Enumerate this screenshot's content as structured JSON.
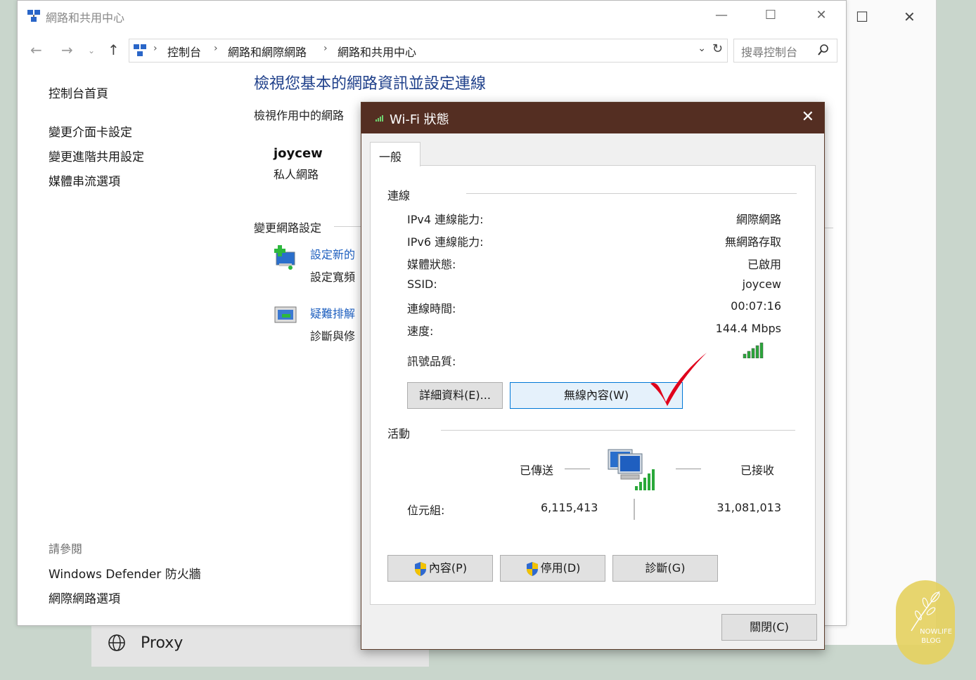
{
  "background": {
    "proxy_label": "Proxy"
  },
  "control_panel": {
    "title": "網路和共用中心",
    "address": {
      "crumbs": [
        "控制台",
        "網路和網際網路",
        "網路和共用中心"
      ]
    },
    "search_placeholder": "搜尋控制台",
    "sidebar": {
      "home": "控制台首頁",
      "links": [
        "變更介面卡設定",
        "變更進階共用設定",
        "媒體串流選項"
      ],
      "see_also_title": "請參閱",
      "see_also": [
        "Windows Defender 防火牆",
        "網際網路選項"
      ]
    },
    "main": {
      "title": "檢視您基本的網路資訊並設定連線",
      "active_networks": "檢視作用中的網路",
      "network_name": "joycew",
      "network_type": "私人網路",
      "change_settings": "變更網路設定",
      "tasks": [
        {
          "link": "設定新的",
          "desc": "設定寬頻"
        },
        {
          "link": "疑難排解",
          "desc": "診斷與修"
        }
      ]
    }
  },
  "wifi_dialog": {
    "title": "Wi-Fi 狀態",
    "tab": "一般",
    "connection_group": "連線",
    "rows": [
      {
        "label": "IPv4 連線能力:",
        "value": "網際網路"
      },
      {
        "label": "IPv6 連線能力:",
        "value": "無網路存取"
      },
      {
        "label": "媒體狀態:",
        "value": "已啟用"
      },
      {
        "label": "SSID:",
        "value": "joycew"
      },
      {
        "label": "連線時間:",
        "value": "00:07:16"
      },
      {
        "label": "速度:",
        "value": "144.4 Mbps"
      }
    ],
    "signal_label": "訊號品質:",
    "signal_bars": 5,
    "details_button": "詳細資料(E)...",
    "wireless_props_button": "無線內容(W)",
    "activity_group": "活動",
    "sent_label": "已傳送",
    "received_label": "已接收",
    "bytes_label": "位元組:",
    "bytes_sent": "6,115,413",
    "bytes_received": "31,081,013",
    "properties_button": "內容(P)",
    "disable_button": "停用(D)",
    "diagnose_button": "診斷(G)",
    "close_button": "關閉(C)",
    "accent_color": "#542e22",
    "checkmark_color": "#e0001b"
  },
  "watermark": {
    "line1": "NOWLIFE",
    "line2": "BLOG"
  }
}
